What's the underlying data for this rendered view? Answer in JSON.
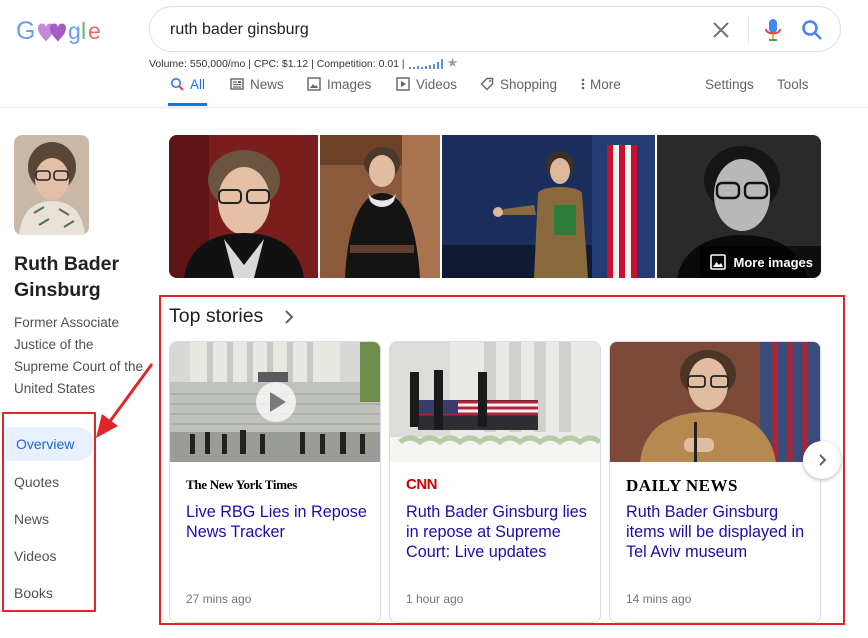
{
  "search": {
    "query": "ruth bader ginsburg",
    "volume_info": "Volume: 550,000/mo | CPC: $1.12 | Competition: 0.01 |"
  },
  "tabs": [
    {
      "label": "All",
      "icon": "search-icon",
      "active": true
    },
    {
      "label": "News",
      "icon": "news-icon"
    },
    {
      "label": "Images",
      "icon": "image-icon"
    },
    {
      "label": "Videos",
      "icon": "video-icon"
    },
    {
      "label": "Shopping",
      "icon": "tag-icon"
    },
    {
      "label": "More",
      "icon": "more-vert-icon"
    },
    {
      "label": "Settings"
    },
    {
      "label": "Tools"
    }
  ],
  "knowledge_panel": {
    "title": "Ruth Bader Ginsburg",
    "description": "Former Associate Justice of the Supreme Court of the United States",
    "nav": [
      "Overview",
      "Quotes",
      "News",
      "Videos",
      "Books"
    ],
    "more_images_label": "More images"
  },
  "top_stories": {
    "heading": "Top stories",
    "cards": [
      {
        "source": "The New York Times",
        "headline": "Live RBG Lies in Repose News Tracker",
        "time": "27 mins ago"
      },
      {
        "source": "CNN",
        "headline": "Ruth Bader Ginsburg lies in repose at Supreme Court: Live updates",
        "time": "1 hour ago"
      },
      {
        "source": "DAILY NEWS",
        "headline": "Ruth Bader Ginsburg items will be displayed in Tel Aviv museum",
        "time": "14 mins ago"
      }
    ]
  },
  "colors": {
    "accent": "#1a73e8",
    "link": "#1a0dab",
    "highlight": "#e0262a"
  }
}
